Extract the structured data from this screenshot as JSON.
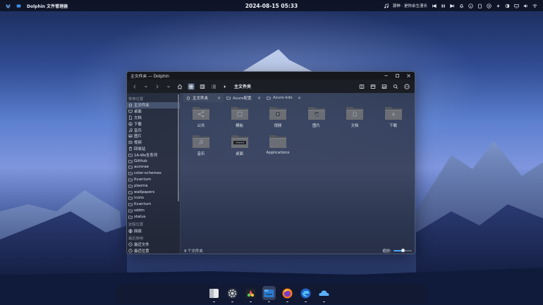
{
  "topbar": {
    "app_name": "Dolphin 文件管理器",
    "clock": "2024-08-15 05:33",
    "now_playing": "源神 · 是你余生漫长",
    "tray_icons": [
      "music-icon",
      "prev-icon",
      "pause-icon",
      "next-icon",
      "bell-icon",
      "info-icon",
      "clipboard-icon",
      "media-icon",
      "bolt-icon",
      "brightness-icon",
      "display-icon",
      "volume-icon",
      "wifi-icon"
    ]
  },
  "window": {
    "title": "主文件夹 — Dolphin",
    "breadcrumb": "主文件夹",
    "sidebar": {
      "places_header": "常用位置",
      "places": [
        {
          "label": "主文件夹",
          "icon": "home-icon",
          "active": true
        },
        {
          "label": "桌面",
          "icon": "desktop-icon"
        },
        {
          "label": "文档",
          "icon": "document-icon"
        },
        {
          "label": "下载",
          "icon": "download-icon"
        },
        {
          "label": "音乐",
          "icon": "music-icon"
        },
        {
          "label": "图片",
          "icon": "image-icon"
        },
        {
          "label": "视频",
          "icon": "video-icon"
        },
        {
          "label": "回收站",
          "icon": "trash-icon"
        },
        {
          "label": "1A-Wo全系列",
          "icon": "folder-icon"
        },
        {
          "label": "GitHub",
          "icon": "folder-icon"
        },
        {
          "label": "aurorae",
          "icon": "folder-icon"
        },
        {
          "label": "color-schemes",
          "icon": "folder-icon"
        },
        {
          "label": "Kvantum",
          "icon": "folder-icon"
        },
        {
          "label": "plasma",
          "icon": "folder-icon"
        },
        {
          "label": "wallpapers",
          "icon": "folder-icon"
        },
        {
          "label": "icons",
          "icon": "folder-icon"
        },
        {
          "label": "Kvantum",
          "icon": "folder-icon"
        },
        {
          "label": "sddm",
          "icon": "folder-icon"
        },
        {
          "label": "status",
          "icon": "folder-icon"
        }
      ],
      "remote_header": "远程位置",
      "remote": [
        {
          "label": "网络",
          "icon": "network-icon"
        }
      ],
      "recent_header": "最近使用",
      "recent": [
        {
          "label": "最近文件",
          "icon": "clock-icon"
        },
        {
          "label": "最近位置",
          "icon": "clock-icon"
        }
      ]
    },
    "tabs": [
      {
        "label": "主文件夹",
        "icon": "home-icon",
        "active": true
      },
      {
        "label": "Azure配置",
        "icon": "folder-icon"
      },
      {
        "label": "Azure-kde",
        "icon": "folder-icon"
      }
    ],
    "tab_close": "×",
    "files": [
      {
        "label": "公共",
        "emblem": "share"
      },
      {
        "label": "模板",
        "emblem": "template"
      },
      {
        "label": "视频",
        "emblem": "video"
      },
      {
        "label": "图片",
        "emblem": "image"
      },
      {
        "label": "文档",
        "emblem": "document"
      },
      {
        "label": "下载",
        "emblem": "download"
      },
      {
        "label": "音乐",
        "emblem": "music"
      },
      {
        "label": "桌面",
        "emblem": "desktop"
      },
      {
        "label": "Applications",
        "emblem": "none"
      }
    ],
    "status": {
      "summary": "9 个文件夹",
      "zoom_label": "缩放:",
      "zoom_level": 0.5
    }
  },
  "dock": {
    "apps": [
      {
        "name": "files-app-icon",
        "active": false
      },
      {
        "name": "settings-app-icon",
        "active": false
      },
      {
        "name": "color-app-icon",
        "active": false
      },
      {
        "name": "dolphin-app-icon",
        "active": true
      },
      {
        "name": "firefox-app-icon",
        "active": false
      },
      {
        "name": "edge-app-icon",
        "active": false
      },
      {
        "name": "cloud-app-icon",
        "active": false
      }
    ]
  },
  "colors": {
    "accent": "#4aa3ff",
    "folder": "#6b6e74",
    "window_bg": "#262a34"
  }
}
